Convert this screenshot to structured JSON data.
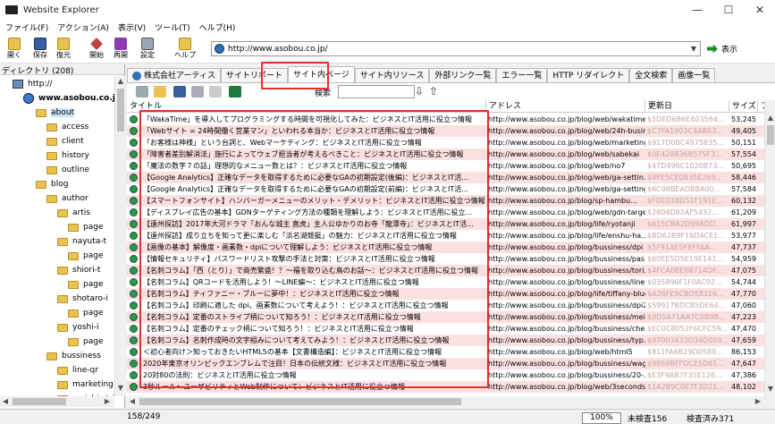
{
  "window": {
    "title": "Website Explorer",
    "minimize": "—",
    "maximize": "☐",
    "close": "✕"
  },
  "menu": [
    "ファイル(F)",
    "アクション(A)",
    "表示(V)",
    "ツール(T)",
    "ヘルプ(H)"
  ],
  "toolbar": {
    "buttons": [
      "開く",
      "保存",
      "復元",
      "開始",
      "再開",
      "設定",
      "ヘルプ"
    ],
    "url": "http://www.asobou.co.jp/",
    "show_label": "表示"
  },
  "left_panel": {
    "header": "ディレクトリ (208)",
    "tree": [
      {
        "label": "http://",
        "kind": "computer",
        "indent": 14
      },
      {
        "label": "www.asobou.co.jp",
        "kind": "web",
        "indent": 26,
        "bold": true
      },
      {
        "label": "about",
        "kind": "folder",
        "indent": 40,
        "selected": true
      },
      {
        "label": "access",
        "kind": "folder",
        "indent": 52
      },
      {
        "label": "client",
        "kind": "folder",
        "indent": 52
      },
      {
        "label": "history",
        "kind": "folder",
        "indent": 52
      },
      {
        "label": "outline",
        "kind": "folder",
        "indent": 52
      },
      {
        "label": "blog",
        "kind": "folder",
        "indent": 40
      },
      {
        "label": "author",
        "kind": "folder",
        "indent": 52
      },
      {
        "label": "artis",
        "kind": "folder",
        "indent": 64
      },
      {
        "label": "page",
        "kind": "folder",
        "indent": 76
      },
      {
        "label": "nayuta-t",
        "kind": "folder",
        "indent": 64
      },
      {
        "label": "page",
        "kind": "folder",
        "indent": 76
      },
      {
        "label": "shiori-t",
        "kind": "folder",
        "indent": 64
      },
      {
        "label": "page",
        "kind": "folder",
        "indent": 76
      },
      {
        "label": "shotaro-i",
        "kind": "folder",
        "indent": 64
      },
      {
        "label": "page",
        "kind": "folder",
        "indent": 76
      },
      {
        "label": "yoshi-i",
        "kind": "folder",
        "indent": 64
      },
      {
        "label": "page",
        "kind": "folder",
        "indent": 76
      },
      {
        "label": "bussiness",
        "kind": "folder",
        "indent": 52
      },
      {
        "label": "line-qr",
        "kind": "folder",
        "indent": 64
      },
      {
        "label": "marketing",
        "kind": "folder",
        "indent": 64
      },
      {
        "label": "meishi-stri",
        "kind": "folder",
        "indent": 64
      }
    ]
  },
  "tabs": [
    "株式会社アーティス",
    "サイトリポート",
    "サイト内ページ",
    "サイト内リソース",
    "外部リンク一覧",
    "エラー一覧",
    "HTTP リダイレクト",
    "全文検索",
    "画像一覧"
  ],
  "active_tab": 2,
  "search_label": "検索",
  "columns": [
    "タイトル",
    "アドレス",
    "更新日",
    "サイズ",
    "ファ"
  ],
  "rows": [
    {
      "title": "「WakaTime」を導入してプログラミングする時間を可視化してみた：ビジネスとIT活用に役立つ情報",
      "url": "http://www.asobou.co.jp/blog/web/wakatime",
      "date": "$5DED6B6E403584...",
      "size": "53,245"
    },
    {
      "title": "「Webサイト = 24時間働く営業マン」といわれる本当か：ビジネスとIT活用に役立つ情報",
      "url": "http://www.asobou.co.jp/blog/web/24h-busin...",
      "date": "$C7FA1903C4AB63...",
      "size": "49,405"
    },
    {
      "title": "「お客様は神様」という台詞と、Webマーケティング：ビジネスとIT活用に役立つ情報",
      "url": "http://www.asobou.co.jp/blog/web/marketing...",
      "date": "$917D0BC4975835...",
      "size": "50,151"
    },
    {
      "title": "「障害者差別解消法」施行によってウェブ担当者が考えるべきこと：ビジネスとIT活用に役立つ情報",
      "url": "http://www.asobou.co.jp/blog/web/sabekai",
      "date": "$0E428836B575F3...",
      "size": "57,554"
    },
    {
      "title": "「魔法の数字７の話」理想的なメニュー数とは？：ビジネスとIT活用に役立つ情報",
      "url": "http://www.asobou.co.jp/blog/web/no7",
      "date": "$47D496C1020B73...",
      "size": "50,695"
    },
    {
      "title": "【Google Analytics】正確なデータを取得するために必要なGAの初期設定(後編)：ビジネスとIT活...",
      "url": "http://www.asobou.co.jp/blog/web/ga-settin...",
      "date": "$8FE5CE0B35E269...",
      "size": "58,446"
    },
    {
      "title": "【Google Analytics】正確なデータを取得するために必要なGAの初期設定(前編)：ビジネスとIT活...",
      "url": "http://www.asobou.co.jp/blog/web/ga-setting",
      "date": "$6C98BEADBBA00...",
      "size": "57,584"
    },
    {
      "title": "【スマートフォンサイト】ハンバーガーメニューのメリット・デメリット：ビジネスとIT活用に役立つ情報",
      "url": "http://www.asobou.co.jp/blog/sp-hambu...",
      "date": "$FDE018D51F191E...",
      "size": "60,132"
    },
    {
      "title": "【ディスプレイ広告の基本】GDNターゲティング方法の種類を理解しよう：ビジネスとIT活用に役立...",
      "url": "http://www.asobou.co.jp/blog/web/gdn-targe...",
      "date": "$2804D82AF5432...",
      "size": "61,209"
    },
    {
      "title": "【遠州探訪】2017年大河ドラマ「おんな城主 直虎」主人公ゆかりのお寺「龍潭寺」：ビジネスとIT活...",
      "url": "http://www.asobou.co.jp/blog/life/ryotanji",
      "date": "$615CBA2D99ADD...",
      "size": "61,997"
    },
    {
      "title": "【遠州探訪】成り立ちを知って更に楽しむ「浜名湖競艇」の魅力：ビジネスとIT活用に役立つ情報",
      "url": "http://www.asobou.co.jp/blog/life/enshu-ha...",
      "date": "$BD62B9F16D4CE1...",
      "size": "53,977"
    },
    {
      "title": "【画像の基本】解像度・画素数・dpiについて理解しよう：ビジネスとIT活用に役立つ情報",
      "url": "http://www.asobou.co.jp/blog/bussiness/dpi",
      "date": "$5F91AE5F8FFAA...",
      "size": "47,737"
    },
    {
      "title": "【情報セキュリティ】パスワードリスト攻撃の手法と対策：ビジネスとIT活用に役立つ情報",
      "url": "http://www.asobou.co.jp/blog/bussiness/pas...",
      "date": "$60EE5D5E19E141...",
      "size": "54,959"
    },
    {
      "title": "【名刺コラム】「西（とり）」で商売繁盛！？～福を取り込む鳥のお話～：ビジネスとIT活用に役立つ情報",
      "url": "http://www.asobou.co.jp/blog/bussiness/tori...",
      "date": "$4FCA0BE08714DF...",
      "size": "47,075"
    },
    {
      "title": "【名刺コラム】QRコードを活用しよう！～LINE編～：ビジネスとIT活用に役立つ情報",
      "url": "http://www.asobou.co.jp/blog/bussiness/line...",
      "date": "$035896F1F0AC92...",
      "size": "54,744"
    },
    {
      "title": "【名刺コラム】ティファニー・ブルーに夢中！：ビジネスとIT活用に役立つ情報",
      "url": "http://www.asobou.co.jp/blog/life/tiffany-blue",
      "date": "$A26FE9CBD58316...",
      "size": "47,770"
    },
    {
      "title": "【名刺コラム】印刷に適した dpi、画素数について考えよう！：ビジネスとIT活用に役立つ情報",
      "url": "http://www.asobou.co.jp/blog/bussiness/dpi2",
      "date": "$59917BDCB5DE64...",
      "size": "47,060"
    },
    {
      "title": "【名刺コラム】定番のストライプ柄について知ろう！：ビジネスとIT活用に役立つ情報",
      "url": "http://www.asobou.co.jp/blog/bussiness/mei...",
      "date": "$0D5A71AA7C0B9B...",
      "size": "47,223"
    },
    {
      "title": "【名刺コラム】定番のチェック柄について知ろう！：ビジネスとIT活用に役立つ情報",
      "url": "http://www.asobou.co.jp/blog/bussiness/che...",
      "date": "$EC0C8052F6CFC59...",
      "size": "47,470"
    },
    {
      "title": "【名刺コラム】名刺作成時の文字組みについて考えてみよう！：ビジネスとIT活用に役立つ情報",
      "url": "http://www.asobou.co.jp/blog/bussiness/typ...",
      "date": "$97003433D34D059...",
      "size": "47,659"
    },
    {
      "title": "＜初心者向け＞知っておきたいHTML5の基本【文書構造編】：ビジネスとIT活用に役立つ情報",
      "url": "http://www.asobou.co.jp/blog/web/html5",
      "date": "$811FA6B29D0589...",
      "size": "86,153"
    },
    {
      "title": "2020年東京オリンピックエンブレムで注目！日本の伝統文様：ビジネスとIT活用に役立つ情報",
      "url": "http://www.asobou.co.jp/blog/bussiness/wag...",
      "date": "$9868BFFDCE5D61...",
      "size": "47,647"
    },
    {
      "title": "20対80の法則：ビジネスとIT活用に役立つ情報",
      "url": "http://www.asobou.co.jp/blog/bussiness/20-...",
      "date": "$E3F9AB7F35E126...",
      "size": "47,386"
    },
    {
      "title": "3秒ルール～ユーザビリティとWeb制作について：ビジネスとIT活用に役立つ情報",
      "url": "http://www.asobou.co.jp/blog/web/3seconds",
      "date": "$1A2B9C0E7F3D21...",
      "size": "48,102"
    }
  ],
  "status": {
    "count": "158/249",
    "zoom": "100%",
    "unchecked": "未検査156",
    "checked": "検査済み371"
  },
  "colors": {
    "highlight": "#e03030",
    "row_alt": "#fbe0e2",
    "selection": "#cce4f7"
  }
}
